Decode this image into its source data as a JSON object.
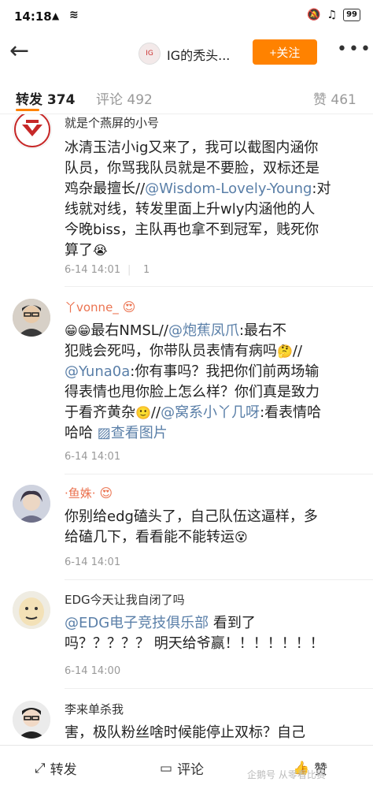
{
  "status": {
    "time": "14:18",
    "net": "▲",
    "wifi": "≋",
    "battery": "99"
  },
  "nav": {
    "back": "←",
    "avatar_text": "IG",
    "title": "IG的秃头...",
    "follow": "+关注",
    "more": "•••"
  },
  "tabs": {
    "repost": "转发 374",
    "comment": "评论 492",
    "like": "赞 461"
  },
  "posts": [
    {
      "user": "就是个燕屏的小号",
      "t1": "冰清玉洁小ig又来了，我可以截图内涵你",
      "t2": "队员，你骂我队员就是不要脸，双标还是",
      "t3a": "鸡杂最擅长//",
      "t3m": "@Wisdom-Lovely-Young",
      "t3b": ":对",
      "t4": "线就对线，转发里面上升wly内涵他的人",
      "t5": "今晚biss，主队再也拿不到冠军，贱死你",
      "t6": "算了",
      "time": "6-14 14:01",
      "likes": "1"
    },
    {
      "user": "丫vonne_",
      "t1a": "最右NMSL//",
      "t1m": "@炮蕉凤爪",
      "t1b": ":最右不",
      "t2": "犯贱会死吗，你带队员表情有病吗",
      "t2b": "//",
      "t3m": "@Yuna0a",
      "t3b": ":你有事吗？我把你们前两场输",
      "t4": "得表情也甩你脸上怎么样？你们真是致力",
      "t5a": "于看齐黄杂",
      "t5b": "//",
      "t5m": "@窝系小丫几呀",
      "t5c": ":看表情哈",
      "t6a": "哈哈 ",
      "t6m": "▨查看图片",
      "time": "6-14 14:01"
    },
    {
      "user": "·鱼姝·",
      "t1": "你别给edg磕头了，自己队伍这逼样，多",
      "t2": "给磕几下，看看能不能转运",
      "time": "6-14 14:01"
    },
    {
      "user": "EDG今天让我自闭了吗",
      "t1m": "@EDG电子竞技俱乐部",
      "t1b": " 看到了",
      "t2": "吗？？？？？ 明天给爷赢！！！！！！！",
      "time": "6-14 14:00"
    },
    {
      "user": "李来单杀我",
      "t1": "害，极队粉丝啥时候能停止双标？自己"
    }
  ],
  "bottom": {
    "repost": "转发",
    "comment": "评论",
    "like": "赞"
  },
  "watermark": "企鹅号 从零看比赛"
}
